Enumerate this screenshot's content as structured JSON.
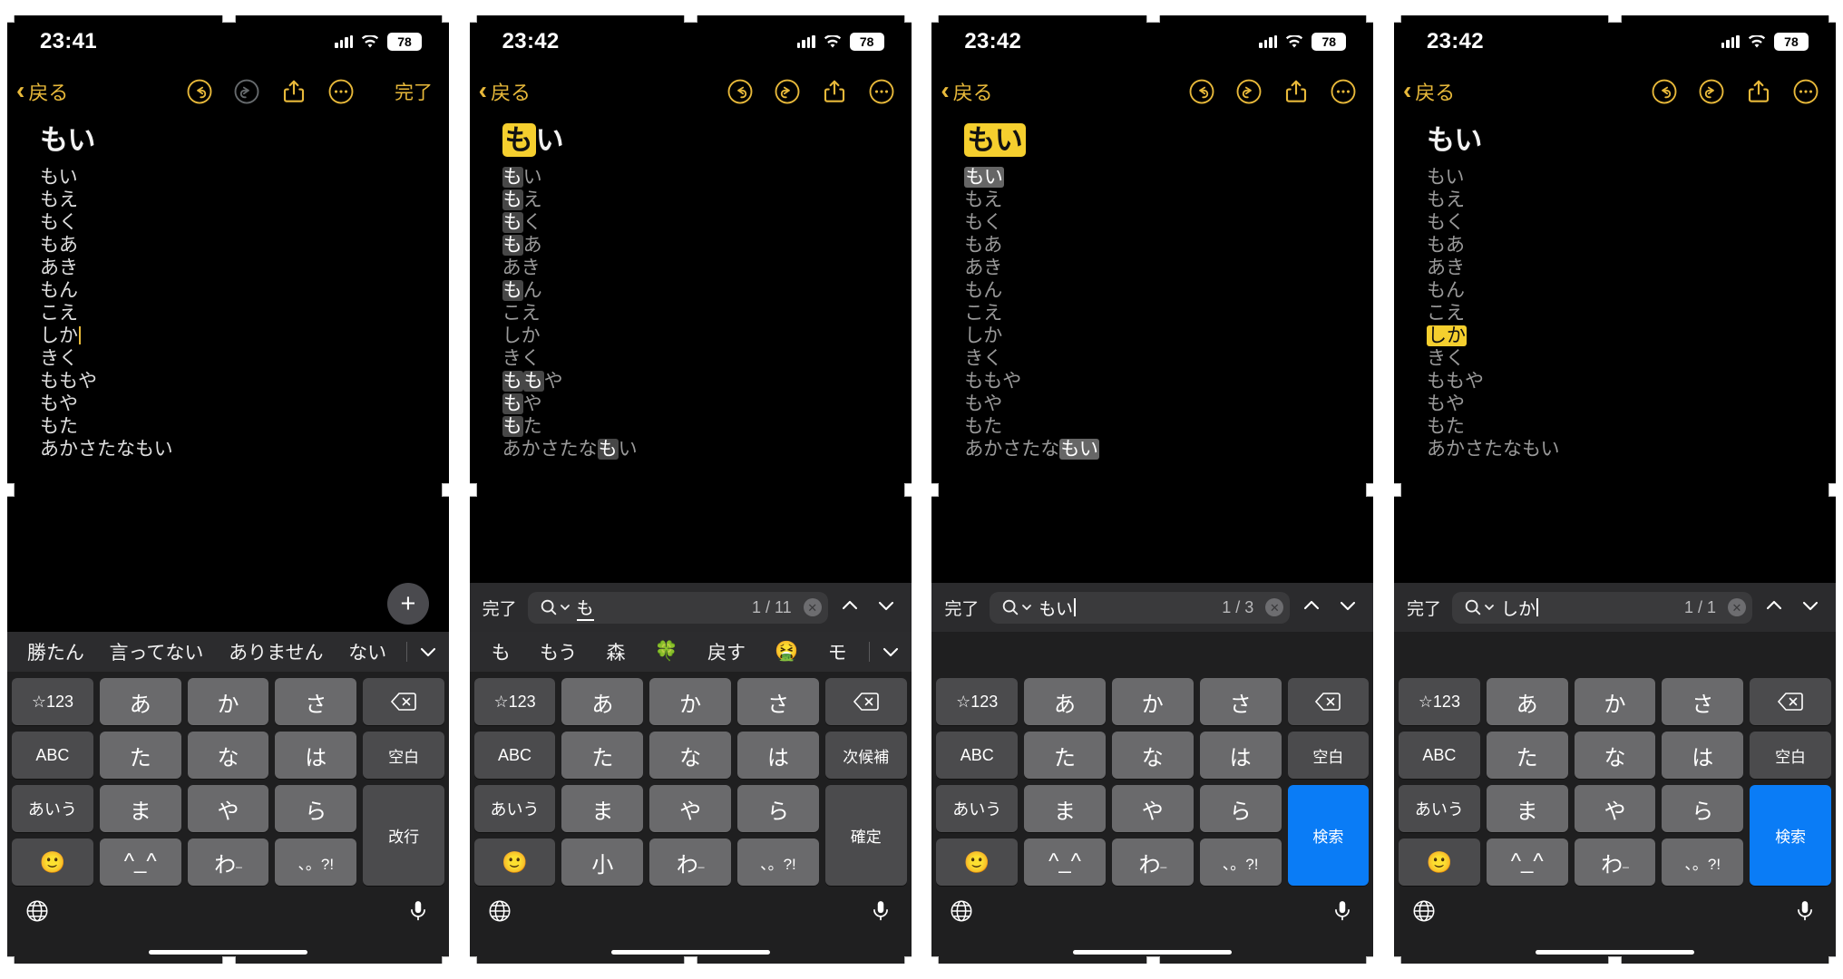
{
  "colors": {
    "accent": "#e8b93a",
    "highlight_current": "#f5cf2e",
    "highlight_other": "#4a4a4a",
    "key_face": "#6a6a6c",
    "key_dark": "#4b4b4d",
    "search_key_blue": "#0a7cf6",
    "background": "#000000"
  },
  "panels": [
    {
      "id": "panel-1",
      "status": {
        "time": "23:41",
        "battery": "78",
        "signal_icon": "cellular-bars-icon",
        "wifi_icon": "wifi-icon"
      },
      "nav": {
        "back_label": "戻る",
        "undo_icon": "undo-icon",
        "redo_icon": "redo-icon",
        "share_icon": "share-icon",
        "more_icon": "more-ellipsis-icon",
        "done_label": "完了",
        "redo_enabled": false
      },
      "note": {
        "title": "もい",
        "lines": [
          "もい",
          "もえ",
          "もく",
          "もあ",
          "あき",
          "もん",
          "こえ",
          "しか",
          "きく",
          "ももや",
          "もや",
          "もた",
          "あかさたなもい"
        ],
        "caret_line_index": 7,
        "add_button_icon": "plus-icon"
      },
      "findbar": null,
      "suggestions": {
        "items": [
          "勝たん",
          "言ってない",
          "ありません",
          "ない"
        ],
        "chevron_icon": "chevron-down-icon"
      },
      "keyboard": {
        "rows": [
          [
            "☆123",
            "あ",
            "か",
            "さ",
            "delete-icon"
          ],
          [
            "ABC",
            "た",
            "な",
            "は",
            "空白"
          ],
          [
            "あいう",
            "ま",
            "や",
            "ら",
            "改行"
          ],
          [
            "emoji-icon",
            "^_^",
            "わ",
            "、。?!"
          ]
        ],
        "return_key_label": "改行",
        "space_key_label": "空白",
        "globe_icon": "globe-icon",
        "mic_icon": "mic-icon"
      }
    },
    {
      "id": "panel-2",
      "status": {
        "time": "23:42",
        "battery": "78",
        "signal_icon": "cellular-bars-icon",
        "wifi_icon": "wifi-icon"
      },
      "nav": {
        "back_label": "戻る",
        "undo_icon": "undo-icon",
        "redo_icon": "redo-icon",
        "share_icon": "share-icon",
        "more_icon": "more-ellipsis-icon",
        "done_label": "",
        "redo_enabled": true
      },
      "note": {
        "title": "もい",
        "title_highlight": "も",
        "lines": [
          "もい",
          "もえ",
          "もく",
          "もあ",
          "あき",
          "もん",
          "こえ",
          "しか",
          "きく",
          "ももや",
          "もや",
          "もた",
          "あかさたなもい"
        ],
        "match_char": "も"
      },
      "findbar": {
        "done_label": "完了",
        "search_icon": "search-magnifier-icon",
        "query": "も",
        "count": "1 / 11",
        "clear_icon": "clear-circle-icon",
        "prev_icon": "chevron-up-icon",
        "next_icon": "chevron-down-icon"
      },
      "suggestions": {
        "items": [
          "も",
          "もう",
          "森",
          "🍀",
          "戻す",
          "🤮",
          "モ"
        ],
        "chevron_icon": "chevron-down-icon"
      },
      "keyboard": {
        "rows": [
          [
            "☆123",
            "あ",
            "か",
            "さ",
            "delete-icon"
          ],
          [
            "ABC",
            "た",
            "な",
            "は",
            "次候補"
          ],
          [
            "あいう",
            "ま",
            "や",
            "ら",
            "確定"
          ],
          [
            "emoji-icon",
            "小",
            "わ",
            "、。?!"
          ]
        ],
        "return_key_label": "確定",
        "space_key_label": "次候補",
        "globe_icon": "globe-icon",
        "mic_icon": "mic-icon"
      }
    },
    {
      "id": "panel-3",
      "status": {
        "time": "23:42",
        "battery": "78",
        "signal_icon": "cellular-bars-icon",
        "wifi_icon": "wifi-icon"
      },
      "nav": {
        "back_label": "戻る",
        "undo_icon": "undo-icon",
        "redo_icon": "redo-icon",
        "share_icon": "share-icon",
        "more_icon": "more-ellipsis-icon",
        "done_label": "",
        "redo_enabled": true
      },
      "note": {
        "title": "もい",
        "title_highlight": "もい",
        "lines": [
          "もい",
          "もえ",
          "もく",
          "もあ",
          "あき",
          "もん",
          "こえ",
          "しか",
          "きく",
          "ももや",
          "もや",
          "もた",
          "あかさたなもい"
        ],
        "match_char": "もい"
      },
      "findbar": {
        "done_label": "完了",
        "search_icon": "search-magnifier-icon",
        "query": "もい",
        "count": "1 / 3",
        "clear_icon": "clear-circle-icon",
        "prev_icon": "chevron-up-icon",
        "next_icon": "chevron-down-icon"
      },
      "suggestions": {
        "items": [],
        "chevron_icon": "chevron-down-icon"
      },
      "keyboard": {
        "rows": [
          [
            "☆123",
            "あ",
            "か",
            "さ",
            "delete-icon"
          ],
          [
            "ABC",
            "た",
            "な",
            "は",
            "空白"
          ],
          [
            "あいう",
            "ま",
            "や",
            "ら",
            "検索"
          ],
          [
            "emoji-icon",
            "^_^",
            "わ",
            "、。?!"
          ]
        ],
        "return_key_label": "検索",
        "space_key_label": "空白",
        "globe_icon": "globe-icon",
        "mic_icon": "mic-icon"
      }
    },
    {
      "id": "panel-4",
      "status": {
        "time": "23:42",
        "battery": "78",
        "signal_icon": "cellular-bars-icon",
        "wifi_icon": "wifi-icon"
      },
      "nav": {
        "back_label": "戻る",
        "undo_icon": "undo-icon",
        "redo_icon": "redo-icon",
        "share_icon": "share-icon",
        "more_icon": "more-ellipsis-icon",
        "done_label": "",
        "redo_enabled": true
      },
      "note": {
        "title": "もい",
        "lines": [
          "もい",
          "もえ",
          "もく",
          "もあ",
          "あき",
          "もん",
          "こえ",
          "しか",
          "きく",
          "ももや",
          "もや",
          "もた",
          "あかさたなもい"
        ],
        "highlight_line_index": 7,
        "highlight_text": "しか"
      },
      "findbar": {
        "done_label": "完了",
        "search_icon": "search-magnifier-icon",
        "query": "しか",
        "count": "1 / 1",
        "clear_icon": "clear-circle-icon",
        "prev_icon": "chevron-up-icon",
        "next_icon": "chevron-down-icon"
      },
      "suggestions": {
        "items": [],
        "chevron_icon": "chevron-down-icon"
      },
      "keyboard": {
        "rows": [
          [
            "☆123",
            "あ",
            "か",
            "さ",
            "delete-icon"
          ],
          [
            "ABC",
            "た",
            "な",
            "は",
            "空白"
          ],
          [
            "あいう",
            "ま",
            "や",
            "ら",
            "検索"
          ],
          [
            "emoji-icon",
            "^_^",
            "わ",
            "、。?!"
          ]
        ],
        "return_key_label": "検索",
        "space_key_label": "空白",
        "globe_icon": "globe-icon",
        "mic_icon": "mic-icon"
      }
    }
  ]
}
